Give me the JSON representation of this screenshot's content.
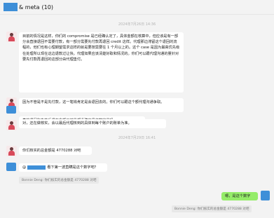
{
  "header": {
    "title_suffix": "& meta",
    "count": "(10)"
  },
  "timestamps": [
    "2024年7月26日 14:36",
    "2024年7月29日",
    "2024年7月29日 16:41"
  ],
  "messages": {
    "m1": "目前的情况是这样，你们的 compromise 是已经确认定了，具体金额在核算中，但应该是有一部分会直接退回不需要付款，有一部分需要先付款再退回 credit 这样。代理那边滞留这个退回的流程的，他们也有心理期望需求这样的就是要按需要在 1 个月以上的。这个 case 是因为最高优先级在处理所以现在这边退款过让快。代理如果应该清楚好取和情况的。你们可以跟代理沟通的量针对要先付款再退回的这部分由代理垫付。",
    "m2": "因为不管是不是先付款，这一笔钱肯定是会退回去的。你们可以跟这个额代理沟通争取。",
    "m3": "直接退回和先垫后退的金额目前是都没确定具体数字是吗",
    "m4": "对，还在做核实，会以最后代理核到的具体到每个账户的账单为准。",
    "m5": "你们核实的总金额是 4770288 对吧",
    "m6_prefix": "@",
    "m6_text": "看下第一波直瞒是这个数字吧？",
    "q6": "Bonnie Deng: 你们核实的总金额是 4770288 对吧",
    "m7": "嗯，是这个数字",
    "q7": "Bonnie Deng: 你们核实的总金额是 4770288 对吧"
  },
  "colors": {
    "self_bubble": "#95ec69",
    "redaction": "#3e8fd8",
    "background": "#f3f3f3"
  }
}
